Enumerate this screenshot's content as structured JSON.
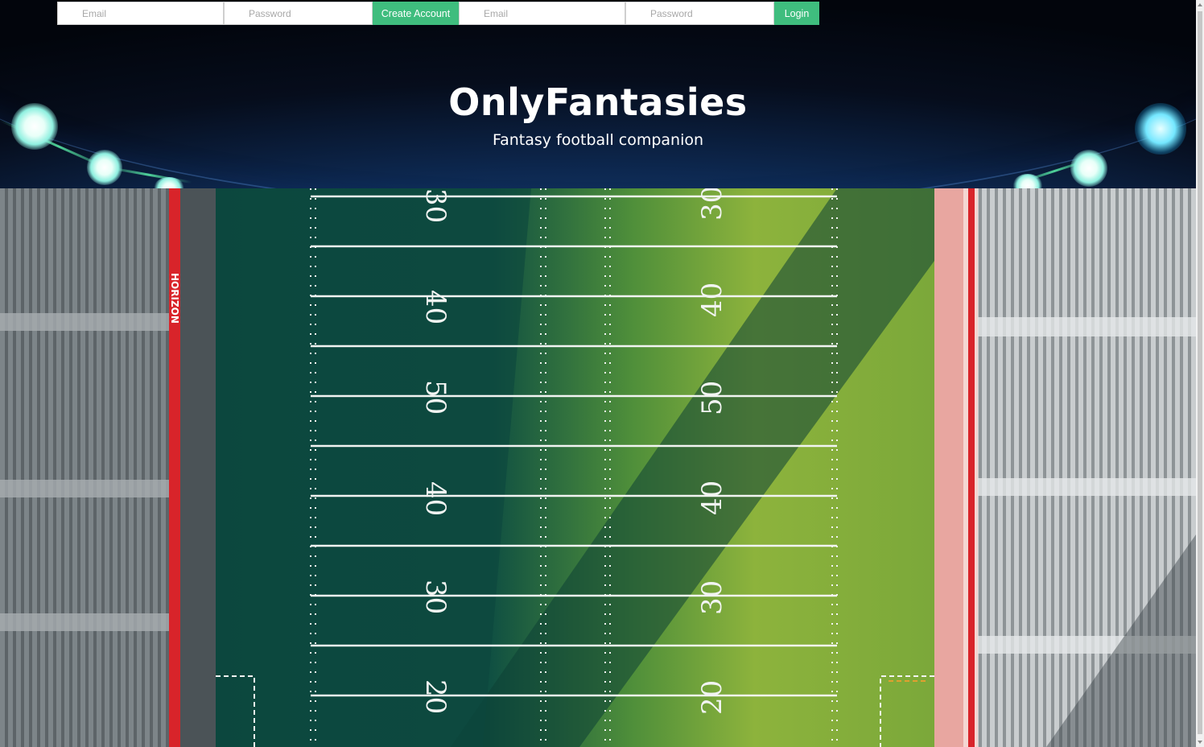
{
  "auth": {
    "signup": {
      "email_placeholder": "Email",
      "password_placeholder": "Password",
      "button_label": "Create Account"
    },
    "login": {
      "email_placeholder": "Email",
      "password_placeholder": "Password",
      "button_label": "Login"
    }
  },
  "hero": {
    "title": "OnlyFantasies",
    "subtitle": "Fantasy football companion"
  },
  "field": {
    "yard_numbers_left": [
      "30",
      "40",
      "50",
      "40",
      "30",
      "20"
    ],
    "yard_numbers_right": [
      "30",
      "40",
      "50",
      "40",
      "30",
      "20"
    ],
    "wall_text": "HORIZON"
  },
  "colors": {
    "accent": "#3fbd7e",
    "header_dark": "#02050c",
    "header_blue": "#2a6fb8",
    "turf_dark": "#0f4a3f",
    "turf_light": "#8fb43a"
  }
}
